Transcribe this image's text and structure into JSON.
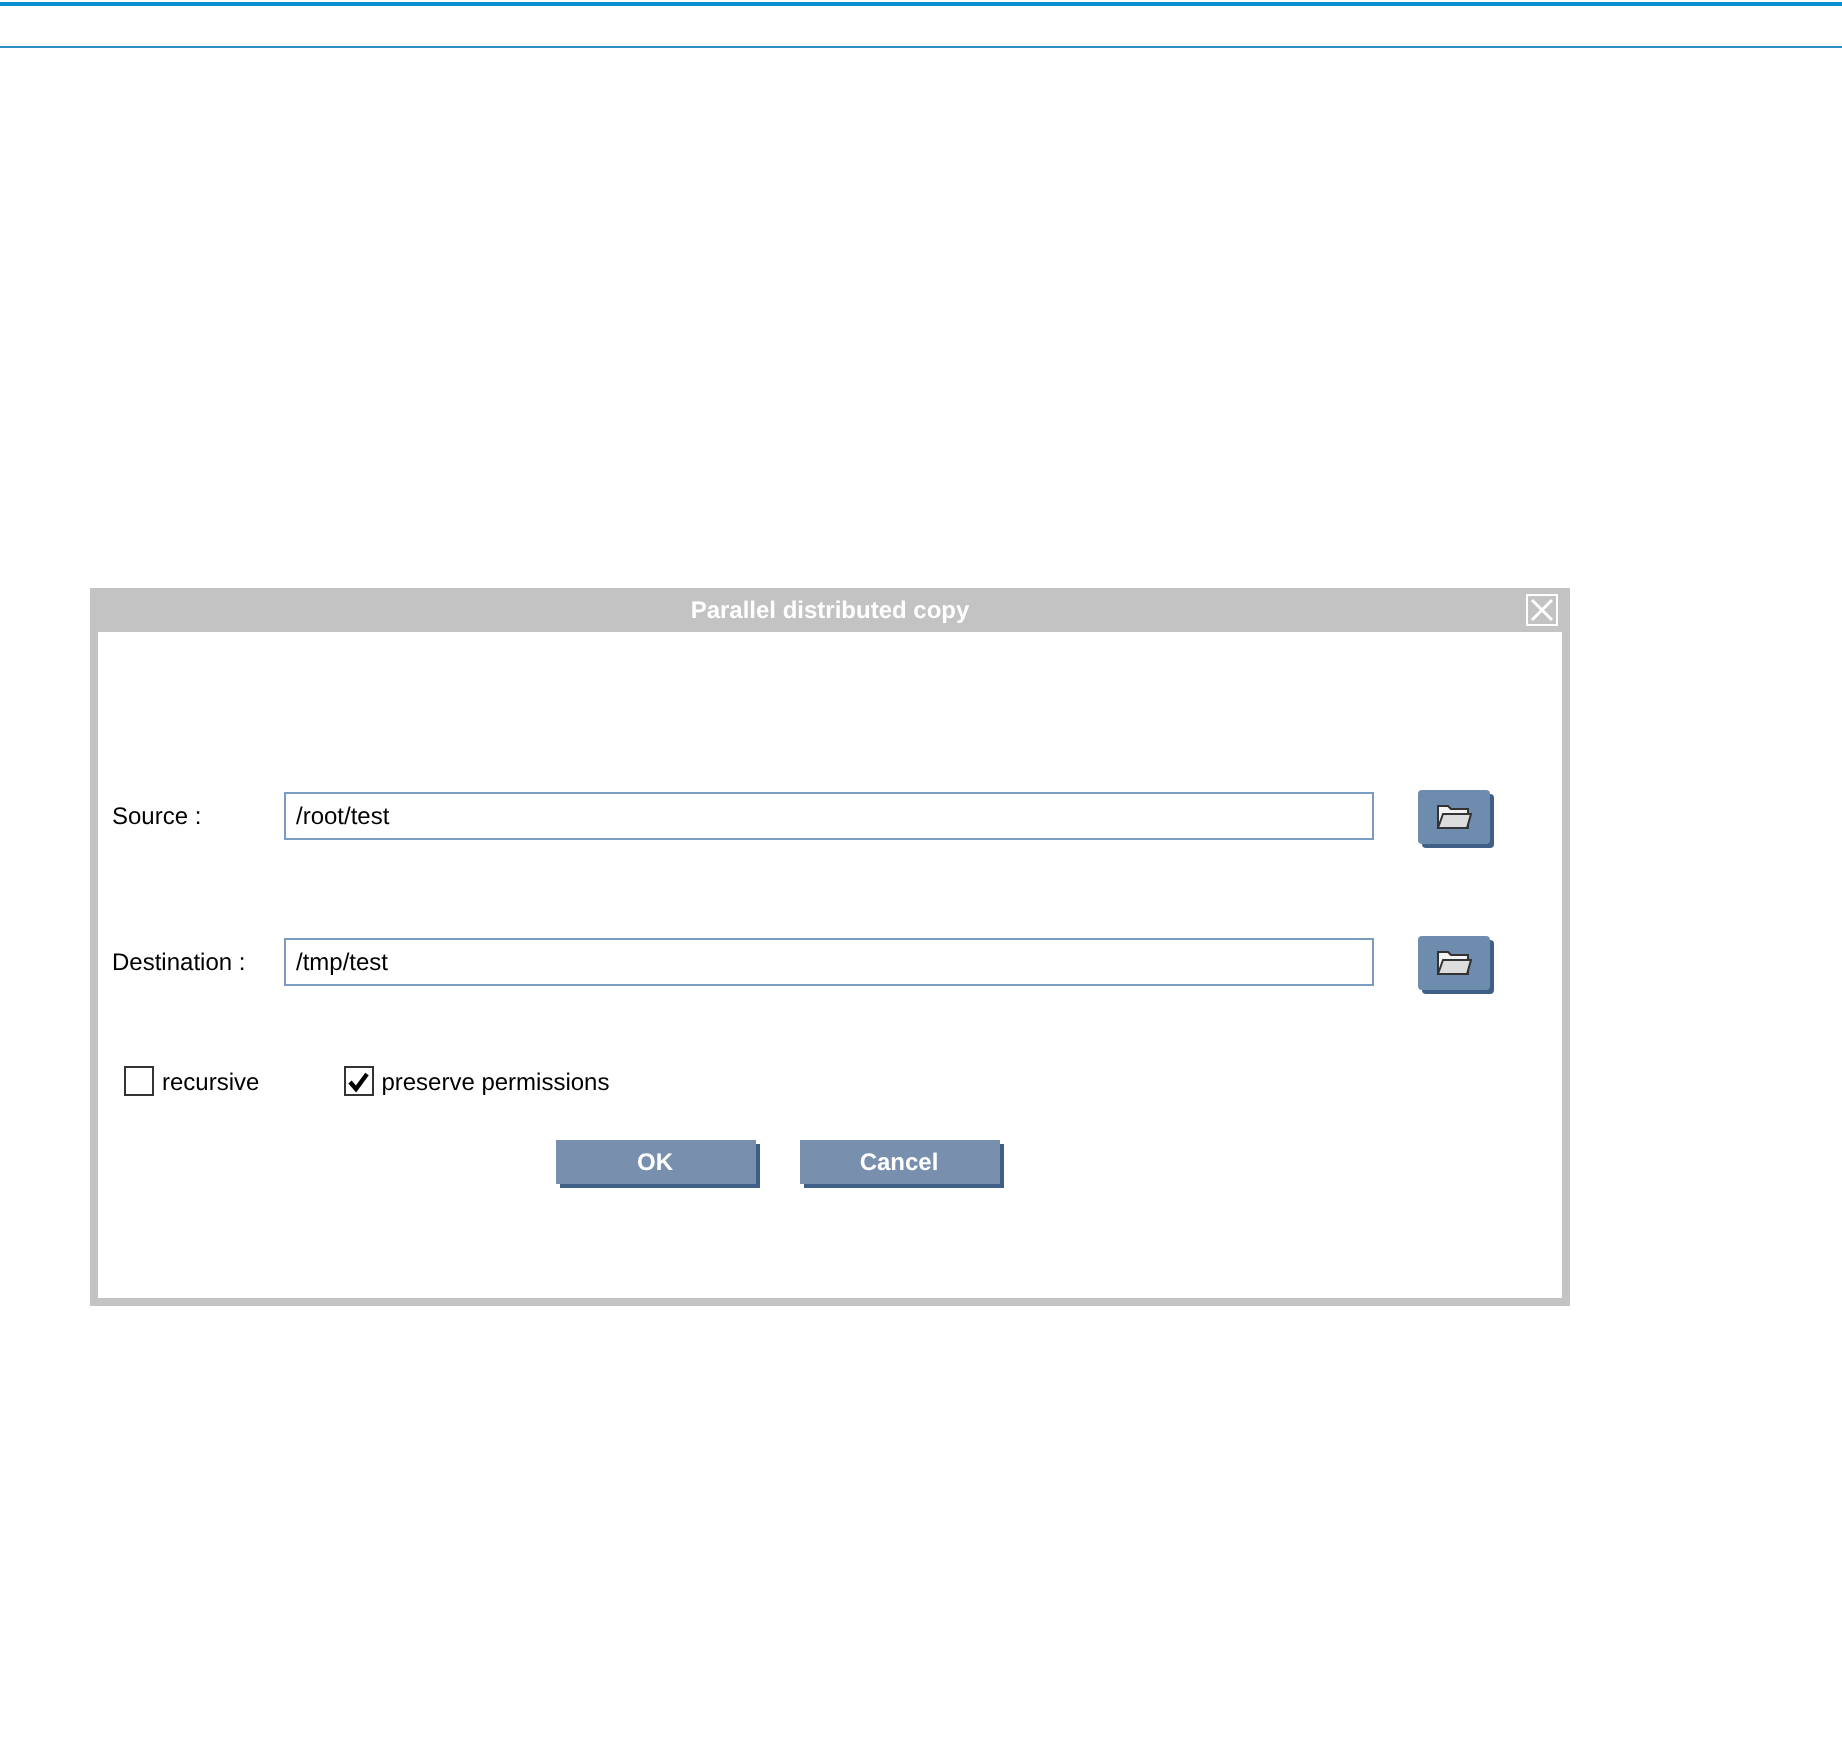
{
  "dialog": {
    "title": "Parallel distributed copy",
    "fields": [
      {
        "label": "Source :",
        "value": "/root/test"
      },
      {
        "label": "Destination :",
        "value": "/tmp/test"
      }
    ],
    "options": [
      {
        "label": "recursive",
        "checked": false
      },
      {
        "label": "preserve permissions",
        "checked": true
      }
    ],
    "buttons": [
      "OK",
      "Cancel"
    ]
  }
}
